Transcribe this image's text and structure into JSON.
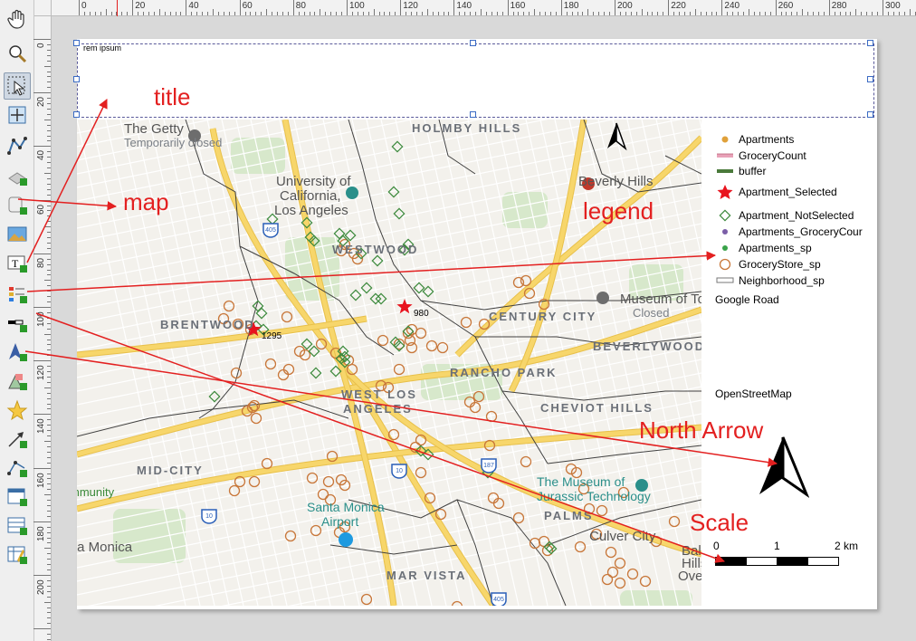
{
  "toolbar": {
    "tools": [
      {
        "name": "pan-tool",
        "icon": "hand-icon"
      },
      {
        "name": "zoom-tool",
        "icon": "magnifier-icon"
      },
      {
        "name": "select-tool",
        "icon": "select-arrow-icon",
        "active": true
      },
      {
        "name": "move-content-tool",
        "icon": "move-content-icon"
      },
      {
        "name": "edit-nodes-tool",
        "icon": "edit-nodes-icon"
      },
      {
        "name": "add-3d-map-tool",
        "icon": "3d-map-icon"
      },
      {
        "name": "add-map-tool",
        "icon": "add-map-icon"
      },
      {
        "name": "add-picture-tool",
        "icon": "add-picture-icon"
      },
      {
        "name": "add-label-tool",
        "icon": "add-label-icon"
      },
      {
        "name": "add-legend-tool",
        "icon": "add-legend-icon"
      },
      {
        "name": "add-scalebar-tool",
        "icon": "add-scalebar-icon"
      },
      {
        "name": "add-north-arrow-tool",
        "icon": "add-north-arrow-icon"
      },
      {
        "name": "add-shape-tool",
        "icon": "add-shape-icon"
      },
      {
        "name": "add-marker-tool",
        "icon": "add-marker-icon"
      },
      {
        "name": "add-arrow-tool",
        "icon": "add-arrow-icon"
      },
      {
        "name": "add-node-item-tool",
        "icon": "add-node-item-icon"
      },
      {
        "name": "add-html-tool",
        "icon": "add-html-icon"
      },
      {
        "name": "add-attribute-table-tool",
        "icon": "add-table-icon"
      },
      {
        "name": "add-fixed-table-tool",
        "icon": "add-fixed-table-icon"
      }
    ]
  },
  "ruler_top": [
    "0",
    "20",
    "40",
    "60",
    "80",
    "100",
    "120",
    "140",
    "160",
    "180",
    "200",
    "220",
    "240",
    "260",
    "280",
    "300"
  ],
  "ruler_left": [
    "0",
    "20",
    "40",
    "60",
    "80",
    "100",
    "120",
    "140",
    "160",
    "180",
    "200"
  ],
  "layout": {
    "title_text": "rem ipsum"
  },
  "map": {
    "places": [
      {
        "text": "The Getty",
        "cls": "lg"
      },
      {
        "text": "Temporarily closed",
        "cls": "gray"
      },
      {
        "text": "University of",
        "cls": "lg"
      },
      {
        "text": "California,",
        "cls": "lg"
      },
      {
        "text": "Los Angeles",
        "cls": "lg"
      },
      {
        "text": "HOLMBY HILLS",
        "cls": ""
      },
      {
        "text": "Beverly Hills",
        "cls": "lg"
      },
      {
        "text": "WESTWOOD",
        "cls": ""
      },
      {
        "text": "BRENTWOOD",
        "cls": ""
      },
      {
        "text": "CENTURY CITY",
        "cls": ""
      },
      {
        "text": "Museum of To",
        "cls": "lg"
      },
      {
        "text": "Closed",
        "cls": "gray"
      },
      {
        "text": "BEVERLYWOOD",
        "cls": ""
      },
      {
        "text": "RANCHO PARK",
        "cls": ""
      },
      {
        "text": "WEST LOS",
        "cls": ""
      },
      {
        "text": "ANGELES",
        "cls": ""
      },
      {
        "text": "CHEVIOT HILLS",
        "cls": ""
      },
      {
        "text": "MID-CITY",
        "cls": ""
      },
      {
        "text": "mmunity",
        "cls": "green"
      },
      {
        "text": "Santa Monica",
        "cls": "teal"
      },
      {
        "text": "Airport",
        "cls": "teal"
      },
      {
        "text": "The Museum of",
        "cls": "teal"
      },
      {
        "text": "Jurassic Technology",
        "cls": "teal"
      },
      {
        "text": "PALMS",
        "cls": ""
      },
      {
        "text": "Culver City",
        "cls": "lg"
      },
      {
        "text": "ta Monica",
        "cls": "lg"
      },
      {
        "text": "MAR VISTA",
        "cls": ""
      },
      {
        "text": "Bald",
        "cls": "lg"
      },
      {
        "text": "Hills S",
        "cls": "lg"
      },
      {
        "text": "Ove",
        "cls": "lg"
      }
    ],
    "highways": [
      "405",
      "10",
      "10",
      "405",
      "187"
    ],
    "apartment_labels": [
      "980",
      "1295"
    ]
  },
  "legend": {
    "items": [
      {
        "label": "Apartments",
        "symbol": "orange-dot"
      },
      {
        "label": "GroceryCount",
        "symbol": "pink-line"
      },
      {
        "label": "buffer",
        "symbol": "green-line"
      },
      {
        "label": "Apartment_Selected",
        "symbol": "red-star"
      },
      {
        "label": "Apartment_NotSelected",
        "symbol": "green-diamond"
      },
      {
        "label": "Apartments_GroceryCour",
        "symbol": "purple-dot"
      },
      {
        "label": "Apartments_sp",
        "symbol": "green-dot"
      },
      {
        "label": "GroceryStore_sp",
        "symbol": "orange-circle"
      },
      {
        "label": "Neighborhood_sp",
        "symbol": "gray-box"
      }
    ],
    "google_road": "Google Road",
    "osm": "OpenStreetMap"
  },
  "scalebar": {
    "labels": [
      "0",
      "1",
      "2 km"
    ]
  },
  "annotations": {
    "title": "title",
    "map": "map",
    "legend": "legend",
    "north_arrow": "North Arrow",
    "scale": "Scale"
  },
  "colors": {
    "annotation": "#e32020",
    "grocery": "#c8773a",
    "not_selected": "#3d8a3d",
    "selected": "#e8141e",
    "road_major": "#f7d66b",
    "park": "#cfe6c3"
  }
}
